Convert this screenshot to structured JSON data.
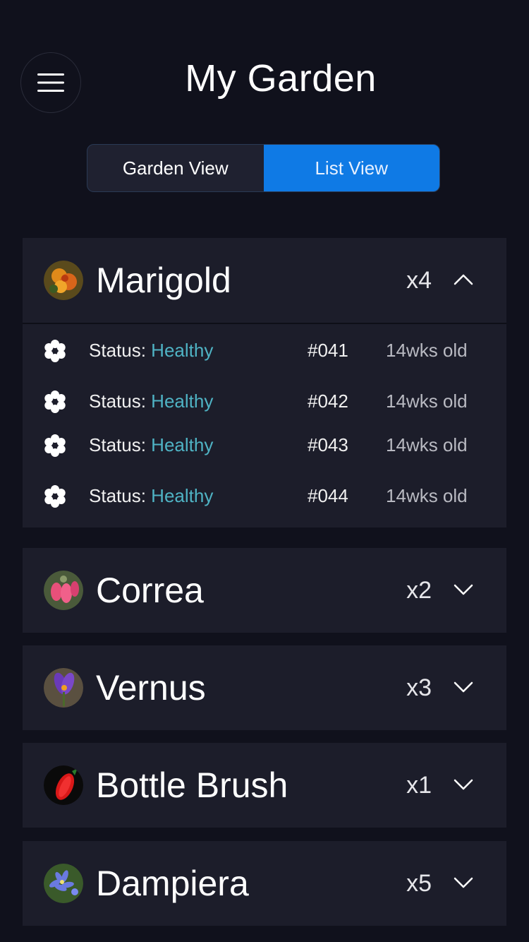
{
  "header": {
    "title": "My Garden",
    "menu_icon": "hamburger-menu-icon"
  },
  "view_toggle": {
    "options": [
      "Garden View",
      "List View"
    ],
    "selected": "List View",
    "accent": "#0f7ae5"
  },
  "colors": {
    "background": "#10111c",
    "card": "#1c1d2a",
    "status_healthy": "#4fb3c4"
  },
  "plants": [
    {
      "name": "Marigold",
      "count": "x4",
      "expanded": true,
      "instances": [
        {
          "status_label": "Status:",
          "status": "Healthy",
          "id": "#041",
          "age": "14wks old"
        },
        {
          "status_label": "Status:",
          "status": "Healthy",
          "id": "#042",
          "age": "14wks old"
        },
        {
          "status_label": "Status:",
          "status": "Healthy",
          "id": "#043",
          "age": "14wks old"
        },
        {
          "status_label": "Status:",
          "status": "Healthy",
          "id": "#044",
          "age": "14wks old"
        }
      ]
    },
    {
      "name": "Correa",
      "count": "x2",
      "expanded": false
    },
    {
      "name": "Vernus",
      "count": "x3",
      "expanded": false
    },
    {
      "name": "Bottle Brush",
      "count": "x1",
      "expanded": false
    },
    {
      "name": "Dampiera",
      "count": "x5",
      "expanded": false
    }
  ]
}
